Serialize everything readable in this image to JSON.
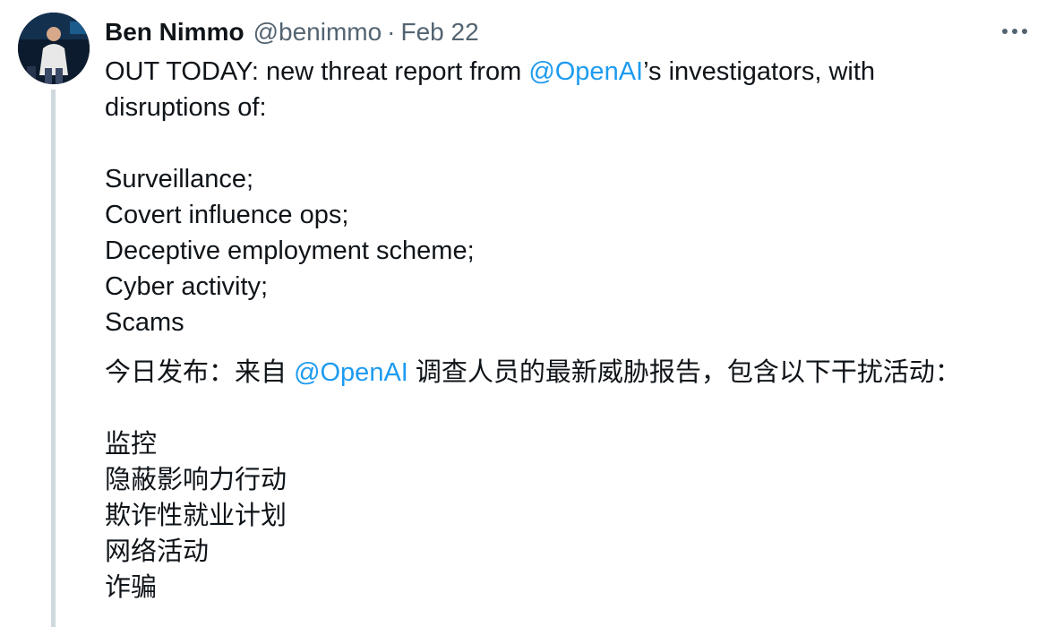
{
  "tweet": {
    "author_name": "Ben Nimmo",
    "handle": "@benimmo",
    "separator": "·",
    "date": "Feb 22",
    "intro_prefix": "OUT TODAY: new threat report from ",
    "intro_mention": "@OpenAI",
    "intro_suffix": "’s investigators, with",
    "intro_line2": "disruptions of:",
    "items_en": [
      "Surveillance;",
      "Covert influence ops;",
      "Deceptive employment scheme;",
      "Cyber activity;",
      "Scams"
    ],
    "zh_prefix": "今日发布：来自 ",
    "zh_mention": "@OpenAI",
    "zh_suffix": " 调查人员的最新威胁报告，包含以下干扰活动：",
    "items_zh": [
      "监控",
      "隐蔽影响力行动",
      "欺诈性就业计划",
      "网络活动",
      "诈骗"
    ]
  },
  "icons": {
    "avatar": "profile-photo",
    "more": "more-horizontal-icon"
  },
  "colors": {
    "mention": "#1d9bf0",
    "secondary_text": "#536471",
    "thread_line": "#cfd9de"
  }
}
